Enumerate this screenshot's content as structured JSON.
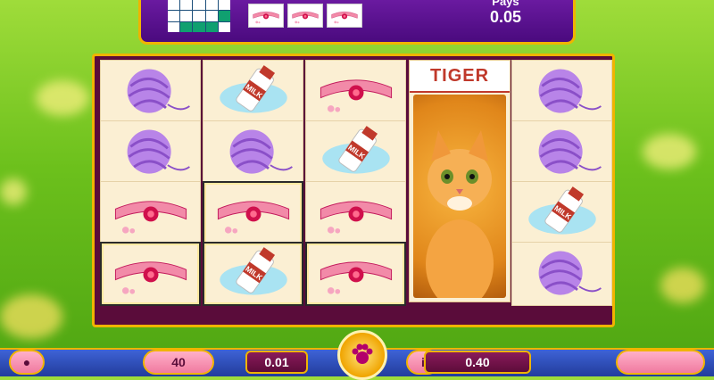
{
  "pays": {
    "label": "Pays",
    "value": "0.05"
  },
  "payline_pattern": [
    [
      0,
      0,
      0,
      0,
      0
    ],
    [
      0,
      0,
      0,
      0,
      1
    ],
    [
      0,
      1,
      1,
      1,
      0
    ]
  ],
  "paying_symbols": [
    "collar-icon",
    "collar-icon",
    "collar-icon"
  ],
  "reels": [
    [
      "yarn-icon",
      "yarn-icon",
      "collar-icon",
      "collar-icon"
    ],
    [
      "milk-icon",
      "yarn-icon",
      "collar-icon",
      "milk-icon"
    ],
    [
      "collar-icon",
      "milk-icon",
      "collar-icon",
      "collar-icon"
    ],
    [
      "tiger"
    ],
    [
      "yarn-icon",
      "yarn-icon",
      "milk-icon",
      "yarn-icon"
    ]
  ],
  "tiger": {
    "label": "TIGER"
  },
  "bottom": {
    "lines": "40",
    "bet": "0.01",
    "total": "0.40"
  },
  "colors": {
    "frame": "#f0b400",
    "panel": "#4a0a7e",
    "reel_bg": "#fbefd3"
  }
}
